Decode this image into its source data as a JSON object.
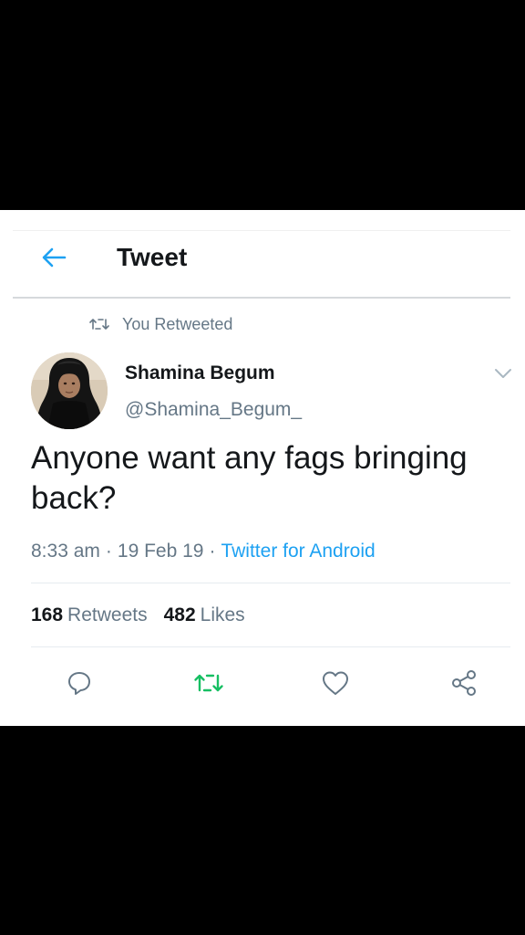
{
  "header": {
    "title": "Tweet",
    "back_icon": "arrow-left-icon"
  },
  "social_context": {
    "icon": "retweet-icon",
    "label": "You Retweeted"
  },
  "tweet": {
    "author": {
      "display_name": "Shamina Begum",
      "handle": "@Shamina_Begum_"
    },
    "text": "Anyone want any fags bringing back?",
    "time": "8:33 am",
    "separator": "·",
    "date": "19 Feb 19",
    "source": "Twitter for Android",
    "stats": {
      "retweets_count": "168",
      "retweets_label": "Retweets",
      "likes_count": "482",
      "likes_label": "Likes"
    }
  },
  "actions": [
    {
      "name": "reply",
      "icon": "reply-icon"
    },
    {
      "name": "retweet",
      "icon": "retweet-icon",
      "active": true
    },
    {
      "name": "like",
      "icon": "heart-icon"
    },
    {
      "name": "share",
      "icon": "share-icon"
    }
  ],
  "colors": {
    "accent": "#1da1f2",
    "retweet_active": "#17bf63",
    "secondary_text": "#657786",
    "primary_text": "#14171a",
    "letterbox": "#000000"
  }
}
